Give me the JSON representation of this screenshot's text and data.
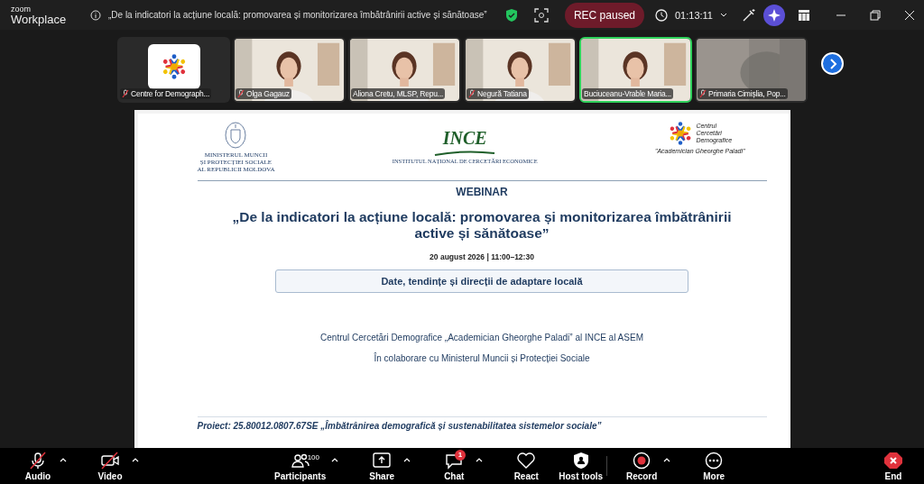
{
  "brand": {
    "line1": "zoom",
    "line2": "Workplace"
  },
  "meeting_title": "„De la indicatori la acțiune locală: promovarea și monitorizarea îmbătrânirii active și sănătoase”",
  "recording": {
    "label": "REC paused"
  },
  "timer": "01:13:11",
  "tiles": [
    {
      "kind": "logo",
      "name": "Centre for Demograph...",
      "muted": true,
      "speaking": false
    },
    {
      "kind": "video",
      "name": "Olga Gagauz",
      "muted": true,
      "speaking": false
    },
    {
      "kind": "video",
      "name": "Aliona Cretu, MLSP, Repu...",
      "muted": false,
      "speaking": false
    },
    {
      "kind": "video",
      "name": "Negură Tatiana",
      "muted": true,
      "speaking": false
    },
    {
      "kind": "video",
      "name": "Buciuceanu-Vrable Maria...",
      "muted": false,
      "speaking": true
    },
    {
      "kind": "blurred",
      "name": "Primaria Cimișlia, Pop...",
      "muted": true,
      "speaking": false
    }
  ],
  "slide": {
    "logos": {
      "ministry": "MINISTERUL MUNCII\nȘI PROTECȚIEI SOCIALE\nAL REPUBLICII MOLDOVA",
      "ince": "INCE",
      "ince_sub": "INSTITUTUL NAȚIONAL DE CERCETĂRI ECONOMICE",
      "centre": "Centrul\nCercetări\nDemografice",
      "centre_sub": "\"Academician Gheorghe Paladi\""
    },
    "kicker": "WEBINAR",
    "title": "„De la indicatori la acțiune locală: promovarea și monitorizarea îmbătrânirii active și sănătoase”",
    "date": "20 august 2026 | 11:00–12:30",
    "topic": "Date, tendințe și direcții de adaptare locală",
    "organizer": "Centrul Cercetări Demografice „Academician Gheorghe Paladi” al INCE al ASEM",
    "partner": "În colaborare cu Ministerul Muncii și Protecției Sociale",
    "project": "Proiect: 25.80012.0807.67SE „Îmbătrânirea demografică și sustenabilitatea sistemelor sociale”"
  },
  "toolbar": [
    {
      "kind": "audio",
      "label": "Audio",
      "off": true,
      "caret": true
    },
    {
      "kind": "video",
      "label": "Video",
      "off": true,
      "caret": true
    },
    {
      "kind": "participants",
      "label": "Participants",
      "count": "100",
      "caret": true
    },
    {
      "kind": "share",
      "label": "Share",
      "caret": true
    },
    {
      "kind": "chat",
      "label": "Chat",
      "badge": "1",
      "caret": true
    },
    {
      "kind": "react",
      "label": "React",
      "caret": false
    },
    {
      "kind": "host",
      "label": "Host tools",
      "caret": false
    },
    {
      "kind": "record",
      "label": "Record",
      "caret": true
    },
    {
      "kind": "more",
      "label": "More",
      "caret": false
    },
    {
      "kind": "end",
      "label": "End",
      "caret": false
    }
  ]
}
